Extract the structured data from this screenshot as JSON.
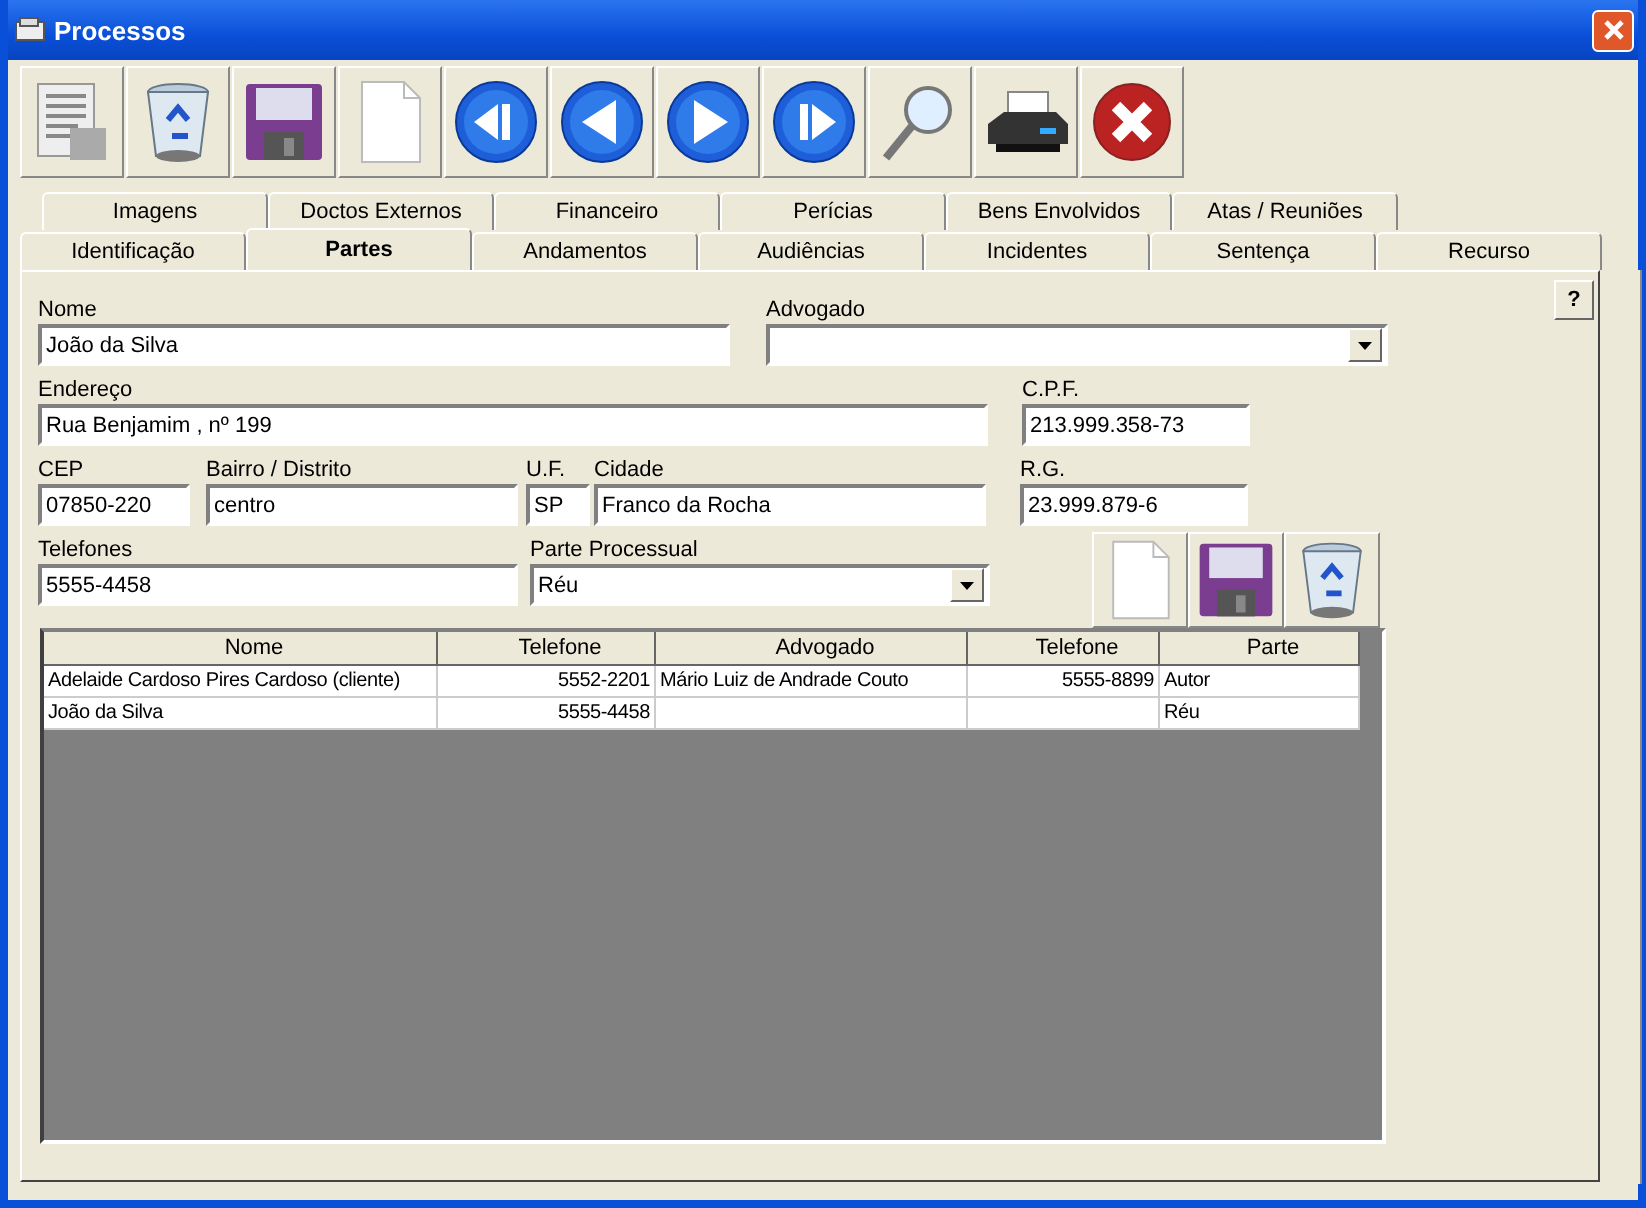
{
  "window": {
    "title": "Processos"
  },
  "toolbar": [
    {
      "kind": "list"
    },
    {
      "kind": "trash"
    },
    {
      "kind": "save"
    },
    {
      "kind": "new"
    },
    {
      "kind": "first"
    },
    {
      "kind": "prev"
    },
    {
      "kind": "next"
    },
    {
      "kind": "last"
    },
    {
      "kind": "search"
    },
    {
      "kind": "print"
    },
    {
      "kind": "close"
    }
  ],
  "tabs_back": [
    {
      "label": "Imagens",
      "selected": false
    },
    {
      "label": "Doctos Externos",
      "selected": false
    },
    {
      "label": "Financeiro",
      "selected": false
    },
    {
      "label": "Perícias",
      "selected": false
    },
    {
      "label": "Bens Envolvidos",
      "selected": false
    },
    {
      "label": "Atas / Reuniões",
      "selected": false
    }
  ],
  "tabs_front": [
    {
      "label": "Identificação",
      "selected": false
    },
    {
      "label": "Partes",
      "selected": true
    },
    {
      "label": "Andamentos",
      "selected": false
    },
    {
      "label": "Audiências",
      "selected": false
    },
    {
      "label": "Incidentes",
      "selected": false
    },
    {
      "label": "Sentença",
      "selected": false
    },
    {
      "label": "Recurso",
      "selected": false
    }
  ],
  "help_button": "?",
  "form_rows": [
    [
      {
        "label": "Nome",
        "value": "João da Silva",
        "kind": "text"
      },
      {
        "label": "Advogado",
        "kind": "select"
      }
    ],
    [
      {
        "label": "Endereço",
        "value": "Rua Benjamim , nº 199",
        "kind": "text"
      },
      {
        "label": "C.P.F.",
        "value": "213.999.358-73",
        "kind": "text"
      }
    ],
    [
      {
        "label": "CEP",
        "value": "07850-220",
        "kind": "text"
      },
      {
        "label": "Bairro / Distrito",
        "value": "centro",
        "kind": "text"
      },
      {
        "label": "U.F.",
        "value": "SP",
        "kind": "text"
      },
      {
        "label": "Cidade",
        "value": "Franco da Rocha",
        "kind": "text"
      },
      {
        "label": "R.G.",
        "value": "23.999.879-6",
        "kind": "text"
      }
    ],
    [
      {
        "label": "Telefones",
        "value": "5555-4458",
        "kind": "text"
      },
      {
        "label": "Parte Processual",
        "value": "Réu",
        "kind": "select"
      }
    ]
  ],
  "row_actions": [
    {
      "kind": "new"
    },
    {
      "kind": "save"
    },
    {
      "kind": "trash"
    }
  ],
  "table": {
    "columns": [
      {
        "label": "Nome",
        "kind": "text"
      },
      {
        "label": "Telefone",
        "kind": "number"
      },
      {
        "label": "Advogado",
        "kind": "text"
      },
      {
        "label": "Telefone",
        "kind": "number"
      },
      {
        "label": "Parte",
        "kind": "text"
      }
    ],
    "rows": [
      [
        "Adelaide Cardoso Pires Cardoso (cliente)",
        "5552-2201",
        "Mário Luiz de Andrade Couto",
        "5555-8899",
        "Autor"
      ],
      [
        "João da Silva",
        "5555-4458",
        "",
        "",
        "Réu"
      ]
    ]
  }
}
